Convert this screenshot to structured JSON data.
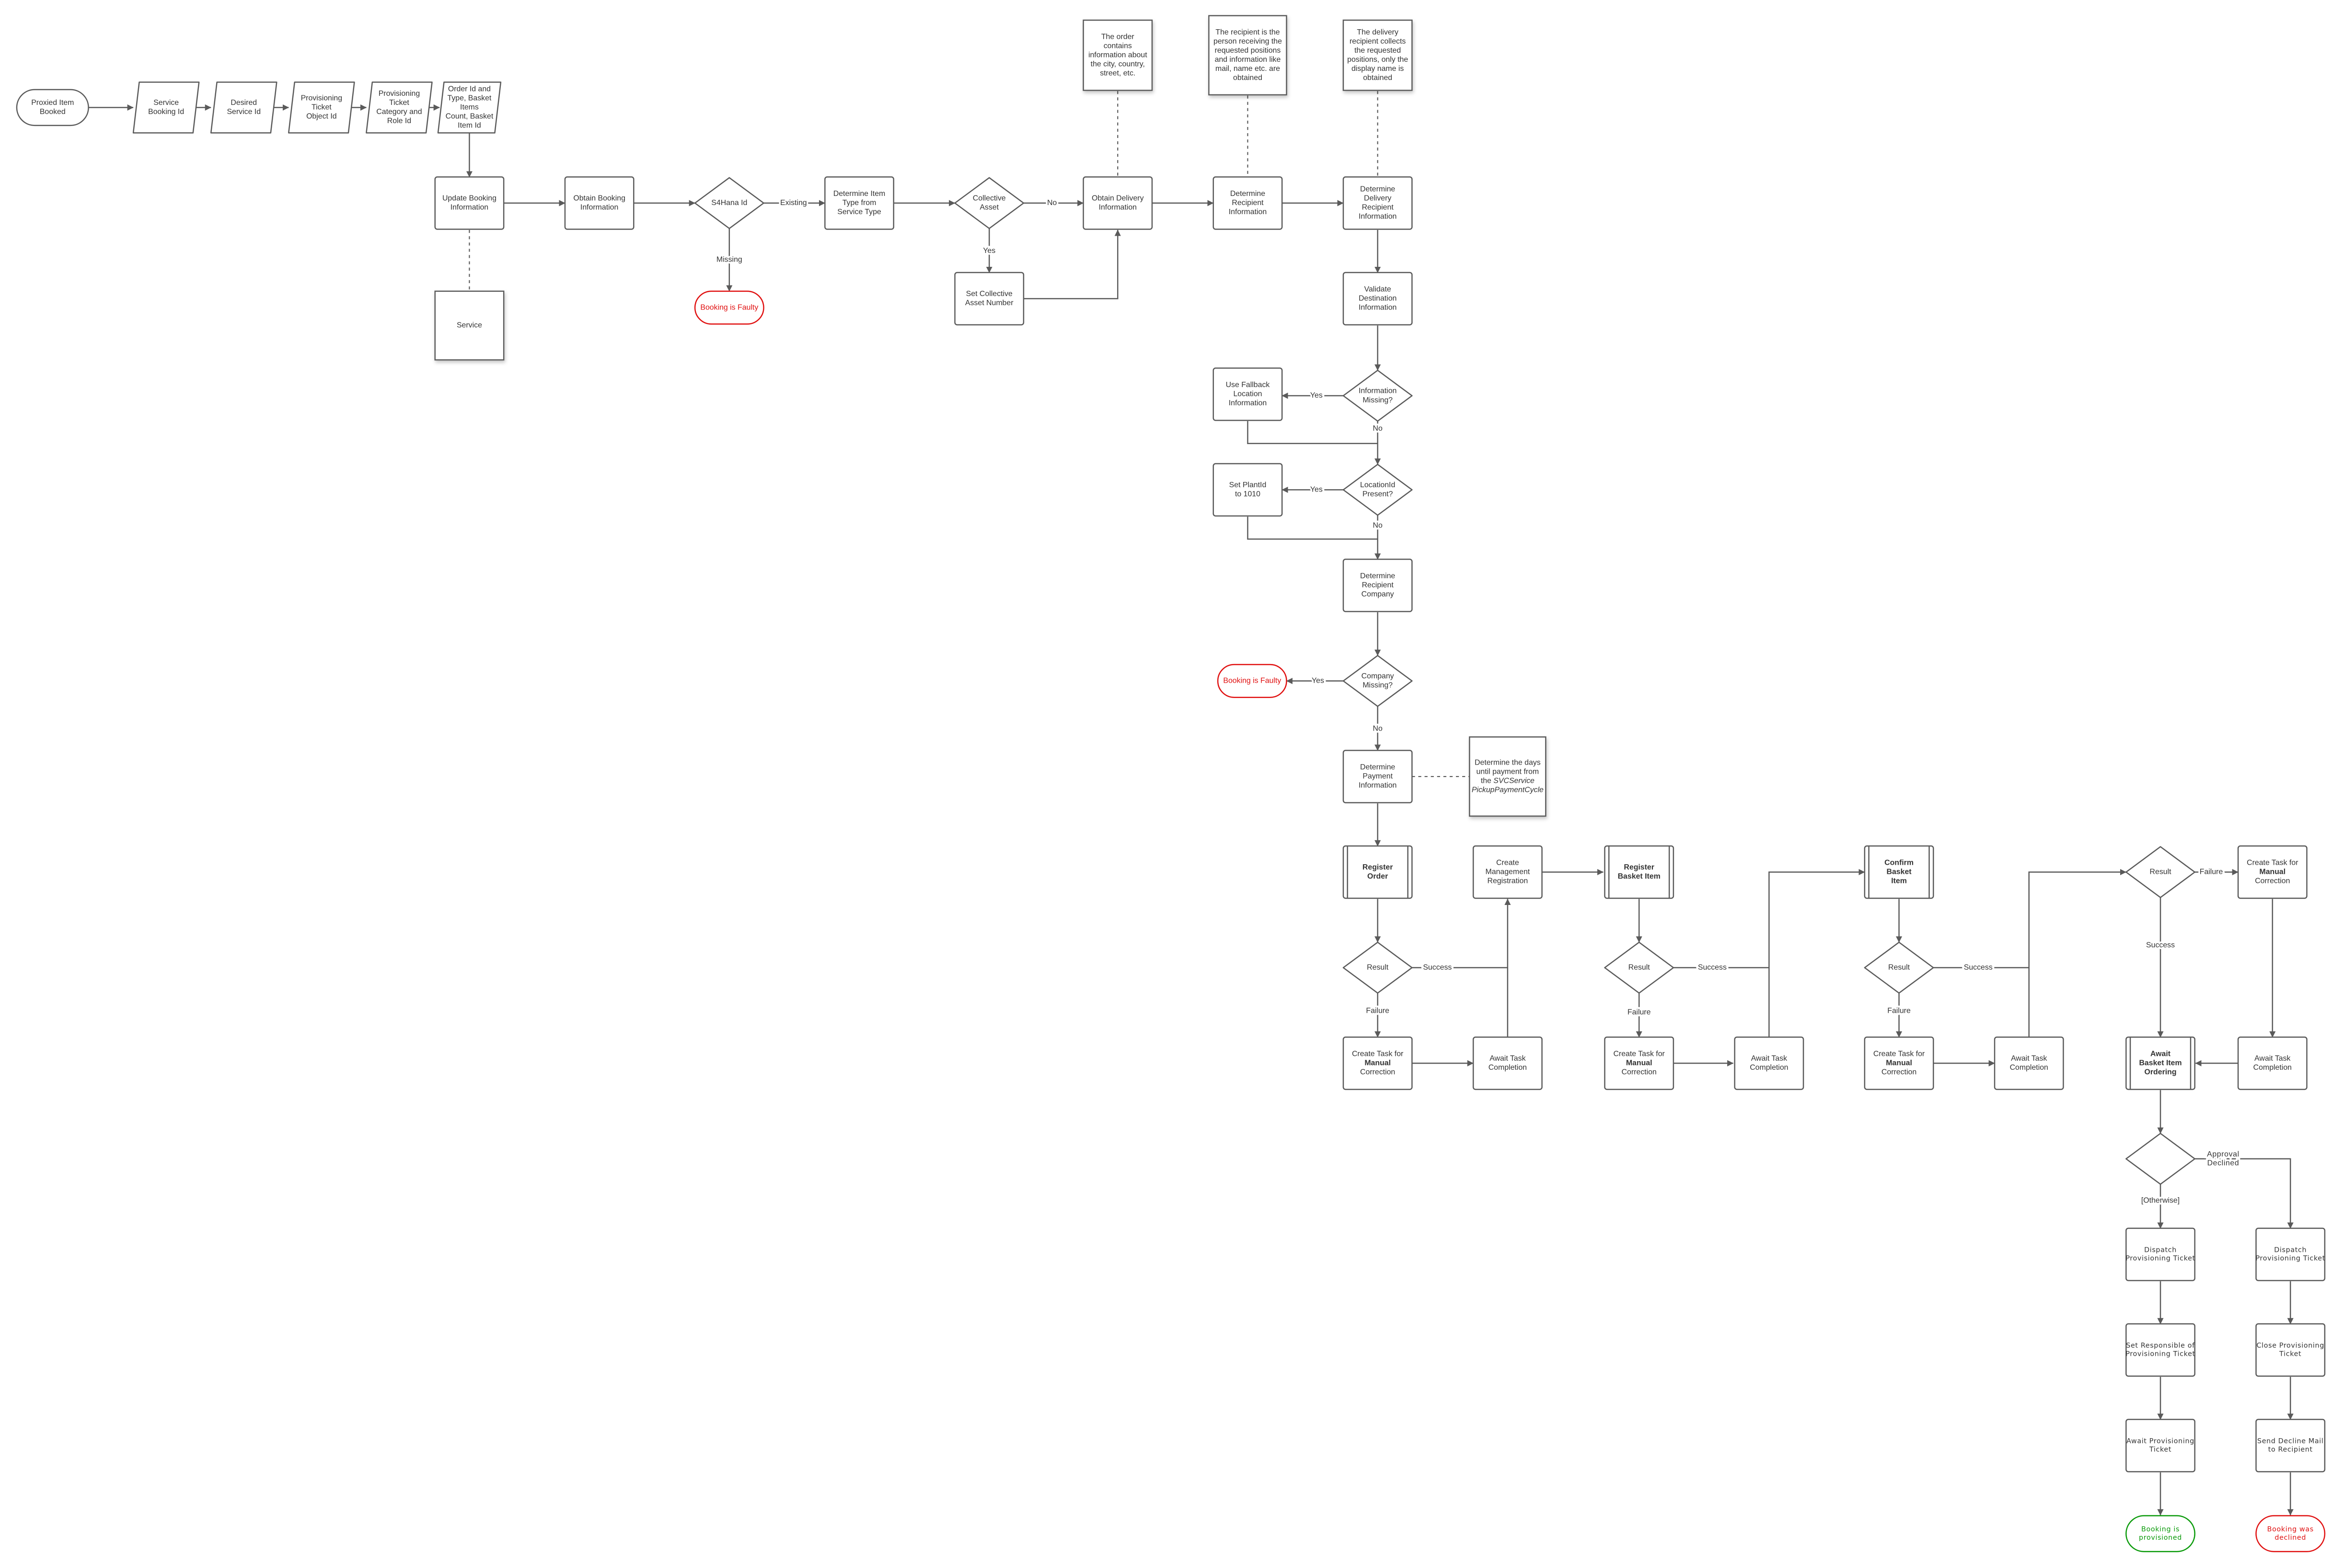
{
  "colors": {
    "stroke": "#5a5a5a",
    "text": "#333333",
    "error": "#e01010",
    "success": "#0a9a0a"
  },
  "nodes": {
    "start": {
      "shape": "terminator",
      "lines": [
        "Proxied Item",
        "Booked"
      ]
    },
    "p1": {
      "shape": "data",
      "lines": [
        "Service",
        "Booking Id"
      ]
    },
    "p2": {
      "shape": "data",
      "lines": [
        "Desired",
        "Service Id"
      ]
    },
    "p3": {
      "shape": "data",
      "lines": [
        "Provisioning",
        "Ticket",
        "Object Id"
      ]
    },
    "p4": {
      "shape": "data",
      "lines": [
        "Provisioning",
        "Ticket",
        "Category and",
        "Role Id"
      ]
    },
    "p5": {
      "shape": "data",
      "lines": [
        "Order Id and",
        "Type, Basket",
        "Items",
        "Count, Basket",
        "Item Id"
      ]
    },
    "update": {
      "shape": "process",
      "lines": [
        "Update Booking",
        "Information"
      ]
    },
    "service": {
      "shape": "note",
      "lines": [
        "Service"
      ]
    },
    "obtain": {
      "shape": "process",
      "lines": [
        "Obtain Booking",
        "Information"
      ]
    },
    "s4": {
      "shape": "decision",
      "lines": [
        "S4Hana Id"
      ]
    },
    "faulty1": {
      "shape": "terminator",
      "color": "error",
      "lines": [
        "Booking is Faulty"
      ]
    },
    "detType": {
      "shape": "process",
      "lines": [
        "Determine Item",
        "Type from",
        "Service Type"
      ]
    },
    "coll": {
      "shape": "decision",
      "lines": [
        "Collective",
        "Asset"
      ]
    },
    "setColl": {
      "shape": "process",
      "lines": [
        "Set Collective",
        "Asset Number"
      ]
    },
    "obtainDel": {
      "shape": "process",
      "lines": [
        "Obtain Delivery",
        "Information"
      ]
    },
    "detRec": {
      "shape": "process",
      "lines": [
        "Determine",
        "Recipient",
        "Information"
      ]
    },
    "detDelRec": {
      "shape": "process",
      "lines": [
        "Determine",
        "Delivery",
        "Recipient",
        "Information"
      ]
    },
    "note1": {
      "shape": "note",
      "lines": [
        "The order",
        "contains",
        "information about",
        "the city, country,",
        "street, etc."
      ]
    },
    "note2": {
      "shape": "note",
      "lines": [
        "The recipient is the",
        "person receiving the",
        "requested positions",
        "and information like",
        "mail, name etc. are",
        "obtained"
      ]
    },
    "note3": {
      "shape": "note",
      "lines": [
        "The delivery",
        "recipient collects",
        "the requested",
        "positions, only the",
        "display name is",
        "obtained"
      ]
    },
    "validate": {
      "shape": "process",
      "lines": [
        "Validate",
        "Destination",
        "Information"
      ]
    },
    "infoMissing": {
      "shape": "decision",
      "lines": [
        "Information",
        "Missing?"
      ]
    },
    "fallback": {
      "shape": "process",
      "lines": [
        "Use Fallback",
        "Location",
        "Information"
      ]
    },
    "locPresent": {
      "shape": "decision",
      "lines": [
        "LocationId",
        "Present?"
      ]
    },
    "setPlant": {
      "shape": "process",
      "lines": [
        "Set PlantId",
        "to 1010"
      ]
    },
    "detComp": {
      "shape": "process",
      "lines": [
        "Determine",
        "Recipient",
        "Company"
      ]
    },
    "compMissing": {
      "shape": "decision",
      "lines": [
        "Company",
        "Missing?"
      ]
    },
    "faulty2": {
      "shape": "terminator",
      "color": "error",
      "lines": [
        "Booking is Faulty"
      ]
    },
    "detPay": {
      "shape": "process",
      "lines": [
        "Determine",
        "Payment",
        "Information"
      ]
    },
    "note4": {
      "shape": "note",
      "lines": [
        [
          "Determine the days"
        ],
        [
          "until payment from"
        ],
        [
          "the ",
          {
            "text": "SVCService",
            "style": "italic"
          }
        ],
        [
          {
            "text": "PickupPaymentCycle",
            "style": "italic"
          }
        ]
      ]
    },
    "regOrder": {
      "shape": "subprocess",
      "bold": true,
      "lines": [
        "Register",
        "Order"
      ]
    },
    "res1": {
      "shape": "decision",
      "lines": [
        "Result"
      ]
    },
    "task1": {
      "shape": "process",
      "lines": [
        [
          "Create Task for"
        ],
        [
          {
            "text": "Manual",
            "style": "bold"
          }
        ],
        [
          "Correction"
        ]
      ]
    },
    "await1": {
      "shape": "process",
      "lines": [
        "Await Task",
        "Completion"
      ]
    },
    "mgmt": {
      "shape": "process",
      "lines": [
        "Create",
        "Management",
        "Registration"
      ]
    },
    "regBasket": {
      "shape": "subprocess",
      "bold": true,
      "lines": [
        "Register",
        "Basket Item"
      ]
    },
    "res2": {
      "shape": "decision",
      "lines": [
        "Result"
      ]
    },
    "task2": {
      "shape": "process",
      "lines": [
        [
          "Create Task for"
        ],
        [
          {
            "text": "Manual",
            "style": "bold"
          }
        ],
        [
          "Correction"
        ]
      ]
    },
    "await2": {
      "shape": "process",
      "lines": [
        "Await Task",
        "Completion"
      ]
    },
    "confirm": {
      "shape": "subprocess",
      "bold": true,
      "lines": [
        "Confirm",
        "Basket",
        "Item"
      ]
    },
    "res3": {
      "shape": "decision",
      "lines": [
        "Result"
      ]
    },
    "task3": {
      "shape": "process",
      "lines": [
        [
          "Create Task for"
        ],
        [
          {
            "text": "Manual",
            "style": "bold"
          }
        ],
        [
          "Correction"
        ]
      ]
    },
    "await3": {
      "shape": "process",
      "lines": [
        "Await Task",
        "Completion"
      ]
    },
    "res4": {
      "shape": "decision",
      "lines": [
        "Result"
      ]
    },
    "task4": {
      "shape": "process",
      "lines": [
        [
          "Create Task for"
        ],
        [
          {
            "text": "Manual",
            "style": "bold"
          }
        ],
        [
          "Correction"
        ]
      ]
    },
    "await4": {
      "shape": "process",
      "lines": [
        "Await Task",
        "Completion"
      ]
    },
    "awaitBasket": {
      "shape": "subprocess",
      "bold": true,
      "lines": [
        "Await",
        "Basket Item",
        "Ordering"
      ]
    },
    "approval": {
      "shape": "decision",
      "lines": []
    },
    "dispatch1": {
      "shape": "process",
      "wide": true,
      "lines": [
        "Dispatch",
        "Provisioning Ticket"
      ]
    },
    "setResp": {
      "shape": "process",
      "wide": true,
      "lines": [
        "Set Responsible of",
        "Provisioning Ticket"
      ]
    },
    "awaitProv": {
      "shape": "process",
      "wide": true,
      "lines": [
        "Await Provisioning",
        "Ticket"
      ]
    },
    "provisioned": {
      "shape": "terminator",
      "color": "success",
      "wide": true,
      "lines": [
        "Booking is",
        "provisioned"
      ]
    },
    "dispatch2": {
      "shape": "process",
      "wide": true,
      "lines": [
        "Dispatch",
        "Provisioning Ticket"
      ]
    },
    "closeTicket": {
      "shape": "process",
      "wide": true,
      "lines": [
        "Close Provisioning",
        "Ticket"
      ]
    },
    "sendDecline": {
      "shape": "process",
      "wide": true,
      "lines": [
        "Send Decline Mail",
        "to Recipient"
      ]
    },
    "declined": {
      "shape": "terminator",
      "color": "error",
      "wide": true,
      "lines": [
        "Booking was",
        "declined"
      ]
    }
  },
  "edge_labels": {
    "existing": "Existing",
    "missing": "Missing",
    "no": "No",
    "yes": "Yes",
    "success": "Success",
    "failure": "Failure",
    "otherwise": "[Otherwise]",
    "approval_declined_1": "Approval",
    "approval_declined_2": "Declined"
  }
}
